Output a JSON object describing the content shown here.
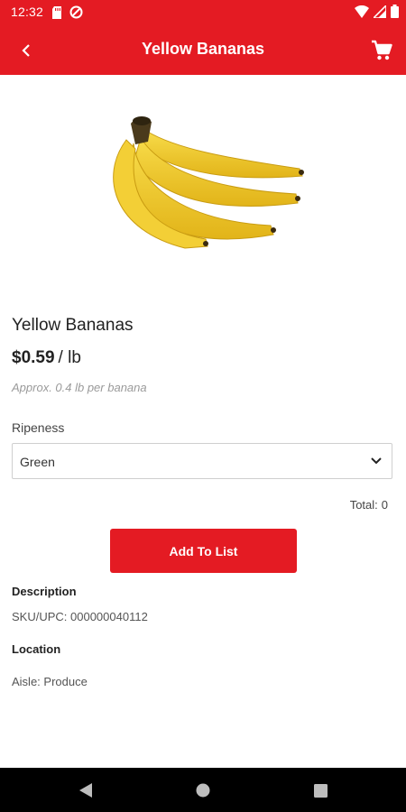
{
  "status_bar": {
    "time": "12:32"
  },
  "app_bar": {
    "title": "Yellow Bananas",
    "back_icon": "chevron-left-icon",
    "cart_icon": "shopping-cart-icon"
  },
  "product": {
    "name": "Yellow Bananas",
    "price": "$0.59",
    "unit": "/ lb",
    "approx": "Approx. 0.4 lb per banana",
    "ripeness_label": "Ripeness",
    "ripeness_value": "Green",
    "total_label": "Total:",
    "total_value": "0",
    "add_button_label": "Add To List"
  },
  "details": {
    "description_heading": "Description",
    "sku": "SKU/UPC: 000000040112",
    "location_heading": "Location",
    "aisle": "Aisle: Produce"
  },
  "colors": {
    "brand_red": "#e41b23",
    "nav_bar": "#000000"
  }
}
